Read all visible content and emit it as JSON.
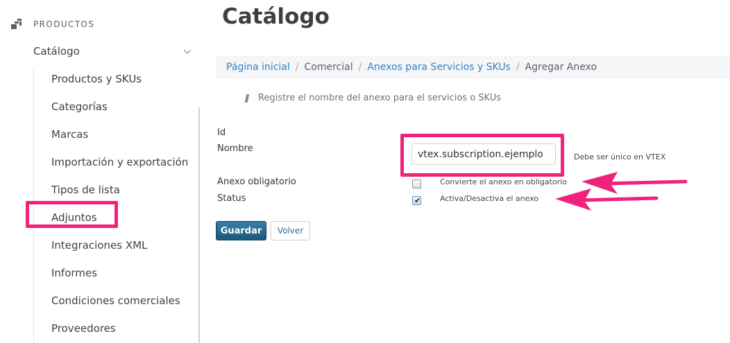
{
  "sidebar": {
    "section_title": "PRODUCTOS",
    "section_icon": "products-icon",
    "category": "Catálogo",
    "items": [
      {
        "label": "Productos y SKUs"
      },
      {
        "label": "Categorías"
      },
      {
        "label": "Marcas"
      },
      {
        "label": "Importación y exportación"
      },
      {
        "label": "Tipos de lista"
      },
      {
        "label": "Adjuntos"
      },
      {
        "label": "Integraciones XML"
      },
      {
        "label": "Informes"
      },
      {
        "label": "Condiciones comerciales"
      },
      {
        "label": "Proveedores"
      }
    ]
  },
  "main": {
    "title": "Catálogo",
    "breadcrumb": {
      "home": "Página inicial",
      "commercial": "Comercial",
      "annexes": "Anexos para Servicios y SKUs",
      "current": "Agregar Anexo",
      "separator": "/"
    },
    "info": "Registre el nombre del anexo para el servicios o SKUs",
    "form": {
      "id_label": "Id",
      "name_label": "Nombre",
      "name_value": "vtex.subscription.ejemplo",
      "name_help": "Debe ser único en VTEX",
      "mandatory_label": "Anexo obligatorio",
      "mandatory_help": "Convierte el anexo en obligatorio",
      "mandatory_checked": false,
      "status_label": "Status",
      "status_help": "Activa/Desactiva el anexo",
      "status_checked": true,
      "check_mark": "✔"
    },
    "buttons": {
      "save": "Guardar",
      "back": "Volver"
    }
  },
  "colors": {
    "highlight": "#f0227a",
    "link": "#2e83c9",
    "save_button": "#1b587e"
  }
}
